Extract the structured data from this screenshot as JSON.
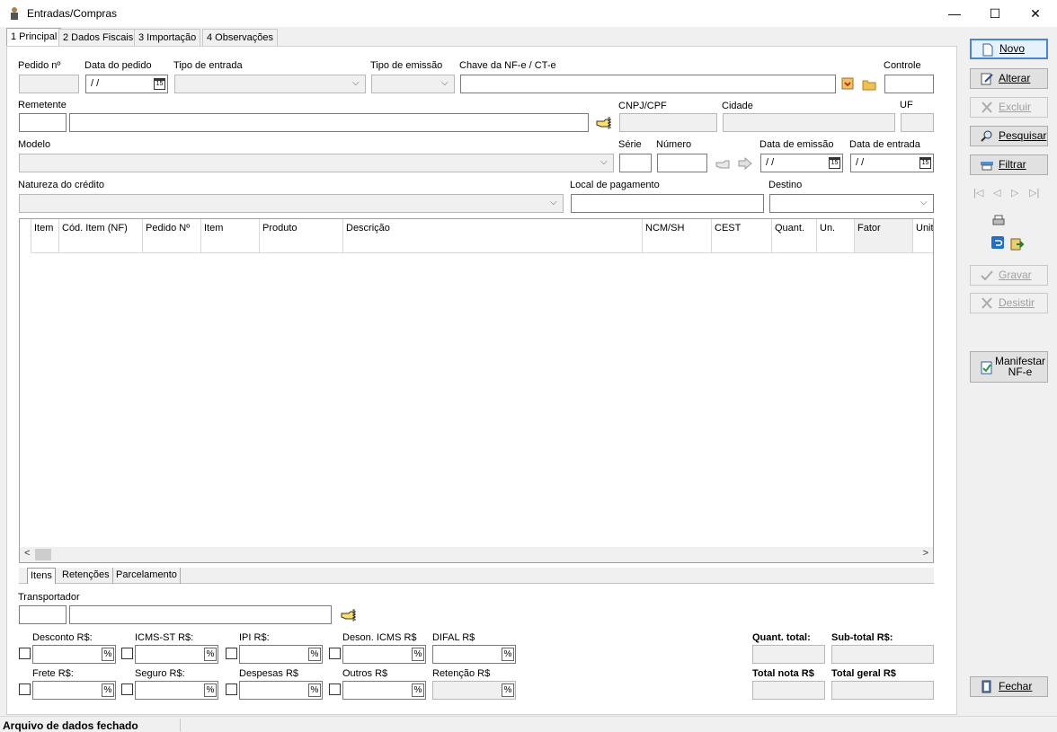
{
  "window": {
    "title": "Entradas/Compras",
    "minimize": "—",
    "maximize": "☐",
    "close": "✕"
  },
  "tabs": [
    "1 Principal",
    "2 Dados Fiscais",
    "3 Importação",
    "4 Observações"
  ],
  "form": {
    "pedido_label": "Pedido nº",
    "data_pedido_label": "Data do pedido",
    "data_pedido_value": "/ /",
    "tipo_entrada_label": "Tipo de entrada",
    "tipo_emissao_label": "Tipo de emissão",
    "chave_label": "Chave da NF-e / CT-e",
    "controle_label": "Controle",
    "remetente_label": "Remetente",
    "cnpj_label": "CNPJ/CPF",
    "cidade_label": "Cidade",
    "uf_label": "UF",
    "modelo_label": "Modelo",
    "serie_label": "Série",
    "numero_label": "Número",
    "data_emissao_label": "Data de emissão",
    "data_emissao_value": "/ /",
    "data_entrada_label": "Data de entrada",
    "data_entrada_value": "/ /",
    "natureza_label": "Natureza do crédito",
    "local_pagamento_label": "Local de pagamento",
    "destino_label": "Destino"
  },
  "grid": {
    "columns": [
      "Item",
      "Cód. Item (NF)",
      "Pedido Nº",
      "Item",
      "Produto",
      "Descrição",
      "NCM/SH",
      "CEST",
      "Quant.",
      "Un.",
      "Fator",
      "Unit"
    ]
  },
  "subtabs": [
    "Itens",
    "Retenções",
    "Parcelamento"
  ],
  "bottom": {
    "transportador_label": "Transportador",
    "desconto_label": "Desconto R$:",
    "icms_st_label": "ICMS-ST R$:",
    "ipi_label": "IPI R$:",
    "deson_label": "Deson. ICMS R$",
    "difal_label": "DIFAL R$",
    "frete_label": "Frete R$:",
    "seguro_label": "Seguro R$:",
    "despesas_label": "Despesas R$",
    "outros_label": "Outros R$",
    "retencao_label": "Retenção R$",
    "percent": "%",
    "quant_total_label": "Quant. total:",
    "subtotal_label": "Sub-total R$:",
    "total_nota_label": "Total nota R$",
    "total_geral_label": "Total geral R$"
  },
  "sidebar": {
    "novo": "Novo",
    "alterar": "Alterar",
    "excluir": "Excluir",
    "pesquisar": "Pesquisar",
    "filtrar": "Filtrar",
    "gravar": "Gravar",
    "desistir": "Desistir",
    "manifestar_line1": "Manifestar",
    "manifestar_line2": "NF-e",
    "fechar": "Fechar"
  },
  "status": {
    "text": "Arquivo de dados fechado"
  },
  "colors": {
    "accent": "#4a86d8",
    "panel": "#ffffff",
    "window_bg": "#f0f0f0"
  }
}
